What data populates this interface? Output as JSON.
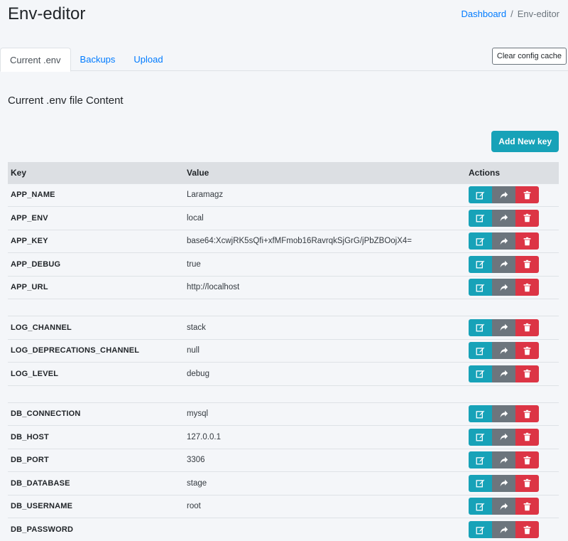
{
  "header": {
    "title": "Env-editor",
    "breadcrumb": {
      "home": "Dashboard",
      "separator": "/",
      "current": "Env-editor"
    }
  },
  "tabs": [
    {
      "label": "Current .env",
      "active": true
    },
    {
      "label": "Backups",
      "active": false
    },
    {
      "label": "Upload",
      "active": false
    }
  ],
  "toolbar": {
    "clear_cache_label": "Clear config cache",
    "add_key_label": "Add New key"
  },
  "section_title": "Current .env file Content",
  "table": {
    "headers": {
      "key": "Key",
      "value": "Value",
      "actions": "Actions"
    },
    "rows": [
      {
        "key": "APP_NAME",
        "value": "Laramagz"
      },
      {
        "key": "APP_ENV",
        "value": "local"
      },
      {
        "key": "APP_KEY",
        "value": "base64:XcwjRK5sQfi+xfMFmob16RavrqkSjGrG/jPbZBOojX4="
      },
      {
        "key": "APP_DEBUG",
        "value": "true"
      },
      {
        "key": "APP_URL",
        "value": "http://localhost"
      },
      {
        "spacer": true
      },
      {
        "key": "LOG_CHANNEL",
        "value": "stack"
      },
      {
        "key": "LOG_DEPRECATIONS_CHANNEL",
        "value": "null"
      },
      {
        "key": "LOG_LEVEL",
        "value": "debug"
      },
      {
        "spacer": true
      },
      {
        "key": "DB_CONNECTION",
        "value": "mysql"
      },
      {
        "key": "DB_HOST",
        "value": "127.0.0.1"
      },
      {
        "key": "DB_PORT",
        "value": "3306"
      },
      {
        "key": "DB_DATABASE",
        "value": "stage"
      },
      {
        "key": "DB_USERNAME",
        "value": "root"
      },
      {
        "key": "DB_PASSWORD",
        "value": ""
      }
    ],
    "action_icons": [
      "edit-icon",
      "share-icon",
      "trash-icon"
    ]
  },
  "colors": {
    "accent": "#17a2b8",
    "secondary": "#6c757d",
    "danger": "#dc3545",
    "link": "#007bff",
    "background": "#f4f6f9"
  }
}
